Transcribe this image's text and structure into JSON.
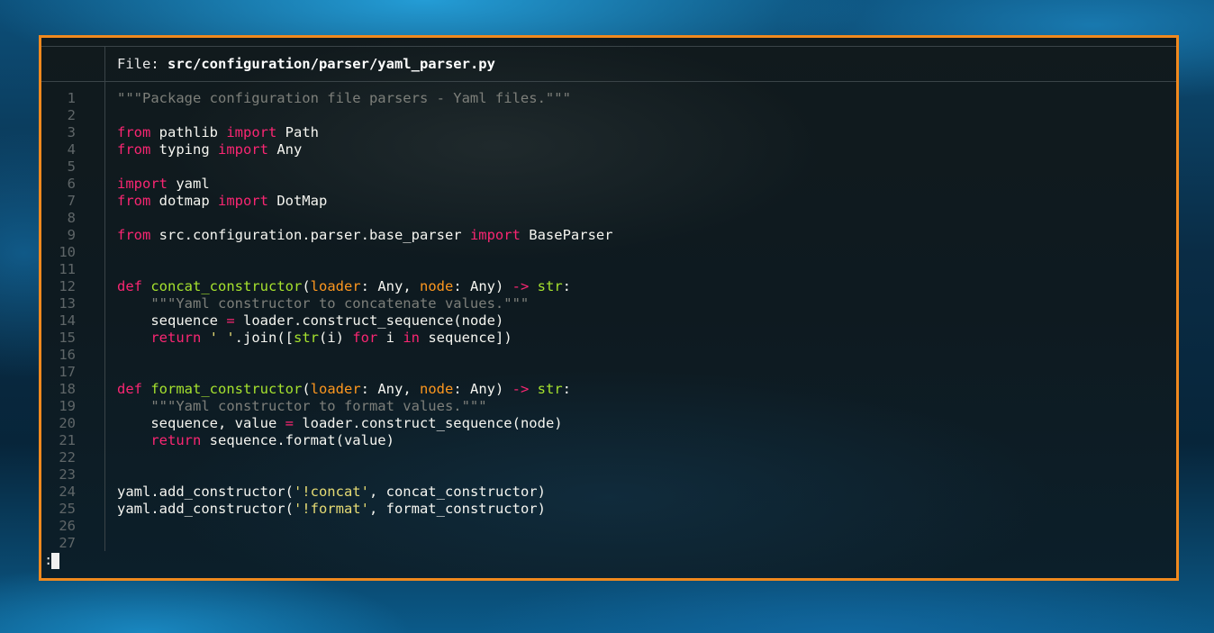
{
  "file": {
    "label": "File: ",
    "path": "src/configuration/parser/yaml_parser.py"
  },
  "lines": [
    {
      "n": "1",
      "t": [
        [
          "cm",
          "\"\"\"Package configuration file parsers - Yaml files.\"\"\""
        ]
      ]
    },
    {
      "n": "2",
      "t": []
    },
    {
      "n": "3",
      "t": [
        [
          "kw",
          "from"
        ],
        [
          "",
          " pathlib "
        ],
        [
          "kw",
          "import"
        ],
        [
          "",
          " Path"
        ]
      ]
    },
    {
      "n": "4",
      "t": [
        [
          "kw",
          "from"
        ],
        [
          "",
          " typing "
        ],
        [
          "kw",
          "import"
        ],
        [
          "",
          " Any"
        ]
      ]
    },
    {
      "n": "5",
      "t": []
    },
    {
      "n": "6",
      "t": [
        [
          "kw",
          "import"
        ],
        [
          "",
          " yaml"
        ]
      ]
    },
    {
      "n": "7",
      "t": [
        [
          "kw",
          "from"
        ],
        [
          "",
          " dotmap "
        ],
        [
          "kw",
          "import"
        ],
        [
          "",
          " DotMap"
        ]
      ]
    },
    {
      "n": "8",
      "t": []
    },
    {
      "n": "9",
      "t": [
        [
          "kw",
          "from"
        ],
        [
          "",
          " src.configuration.parser.base_parser "
        ],
        [
          "kw",
          "import"
        ],
        [
          "",
          " BaseParser"
        ]
      ]
    },
    {
      "n": "10",
      "t": []
    },
    {
      "n": "11",
      "t": []
    },
    {
      "n": "12",
      "t": [
        [
          "kw",
          "def"
        ],
        [
          "",
          " "
        ],
        [
          "fn",
          "concat_constructor"
        ],
        [
          "",
          "("
        ],
        [
          "pm",
          "loader"
        ],
        [
          "",
          ": Any, "
        ],
        [
          "pm",
          "node"
        ],
        [
          "",
          ": Any) "
        ],
        [
          "kw",
          "->"
        ],
        [
          "",
          " "
        ],
        [
          "ty",
          "str"
        ],
        [
          "",
          ":"
        ]
      ]
    },
    {
      "n": "13",
      "t": [
        [
          "",
          "    "
        ],
        [
          "cm",
          "\"\"\"Yaml constructor to concatenate values.\"\"\""
        ]
      ]
    },
    {
      "n": "14",
      "t": [
        [
          "",
          "    sequence "
        ],
        [
          "kw",
          "="
        ],
        [
          "",
          " loader.construct_sequence(node)"
        ]
      ]
    },
    {
      "n": "15",
      "t": [
        [
          "",
          "    "
        ],
        [
          "kw",
          "return"
        ],
        [
          "",
          " "
        ],
        [
          "st",
          "' '"
        ],
        [
          "",
          ".join(["
        ],
        [
          "ty",
          "str"
        ],
        [
          "",
          "(i) "
        ],
        [
          "kw",
          "for"
        ],
        [
          "",
          " i "
        ],
        [
          "kw",
          "in"
        ],
        [
          "",
          " sequence])"
        ]
      ]
    },
    {
      "n": "16",
      "t": []
    },
    {
      "n": "17",
      "t": []
    },
    {
      "n": "18",
      "t": [
        [
          "kw",
          "def"
        ],
        [
          "",
          " "
        ],
        [
          "fn",
          "format_constructor"
        ],
        [
          "",
          "("
        ],
        [
          "pm",
          "loader"
        ],
        [
          "",
          ": Any, "
        ],
        [
          "pm",
          "node"
        ],
        [
          "",
          ": Any) "
        ],
        [
          "kw",
          "->"
        ],
        [
          "",
          " "
        ],
        [
          "ty",
          "str"
        ],
        [
          "",
          ":"
        ]
      ]
    },
    {
      "n": "19",
      "t": [
        [
          "",
          "    "
        ],
        [
          "cm",
          "\"\"\"Yaml constructor to format values.\"\"\""
        ]
      ]
    },
    {
      "n": "20",
      "t": [
        [
          "",
          "    sequence, value "
        ],
        [
          "kw",
          "="
        ],
        [
          "",
          " loader.construct_sequence(node)"
        ]
      ]
    },
    {
      "n": "21",
      "t": [
        [
          "",
          "    "
        ],
        [
          "kw",
          "return"
        ],
        [
          "",
          " sequence.format(value)"
        ]
      ]
    },
    {
      "n": "22",
      "t": []
    },
    {
      "n": "23",
      "t": []
    },
    {
      "n": "24",
      "t": [
        [
          "",
          "yaml.add_constructor("
        ],
        [
          "st",
          "'!concat'"
        ],
        [
          "",
          ", concat_constructor)"
        ]
      ]
    },
    {
      "n": "25",
      "t": [
        [
          "",
          "yaml.add_constructor("
        ],
        [
          "st",
          "'!format'"
        ],
        [
          "",
          ", format_constructor)"
        ]
      ]
    },
    {
      "n": "26",
      "t": []
    },
    {
      "n": "27",
      "t": []
    }
  ],
  "prompt": ":",
  "colors": {
    "border": "#f0891e",
    "keyword": "#f92672",
    "comment": "#7d7f7a",
    "function": "#a6e22e",
    "param": "#fd971f",
    "string": "#e6db74"
  }
}
